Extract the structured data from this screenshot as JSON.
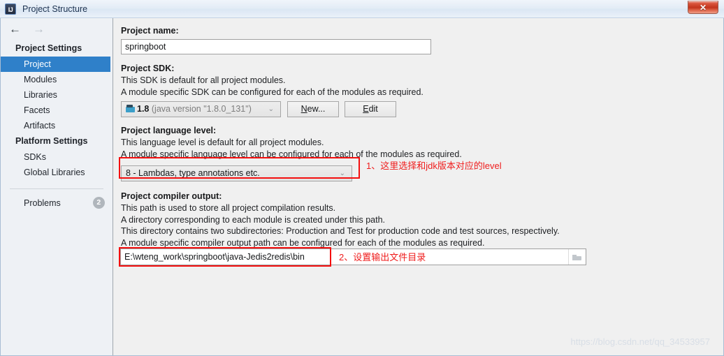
{
  "window": {
    "title": "Project Structure",
    "app_icon": "IJ",
    "close_label": "✕"
  },
  "nav": {
    "back_icon": "←",
    "forward_icon": "→"
  },
  "sidebar": {
    "groups": [
      {
        "header": "Project Settings",
        "items": [
          {
            "label": "Project",
            "selected": true
          },
          {
            "label": "Modules",
            "selected": false
          },
          {
            "label": "Libraries",
            "selected": false
          },
          {
            "label": "Facets",
            "selected": false
          },
          {
            "label": "Artifacts",
            "selected": false
          }
        ]
      },
      {
        "header": "Platform Settings",
        "items": [
          {
            "label": "SDKs",
            "selected": false
          },
          {
            "label": "Global Libraries",
            "selected": false
          }
        ]
      }
    ],
    "problems": {
      "label": "Problems",
      "badge": "2"
    }
  },
  "main": {
    "project_name": {
      "label": "Project name:",
      "value": "springboot"
    },
    "project_sdk": {
      "label": "Project SDK:",
      "desc_1": "This SDK is default for all project modules.",
      "desc_2": "A module specific SDK can be configured for each of the modules as required.",
      "combo_version": "1.8",
      "combo_detail": "(java version \"1.8.0_131\")",
      "combo_arrow": "⌄",
      "new_button": "New...",
      "new_button_mnemonic": "N",
      "edit_button": "Edit",
      "edit_button_mnemonic": "E"
    },
    "language_level": {
      "label": "Project language level:",
      "desc_1": "This language level is default for all project modules.",
      "desc_2": "A module specific language level can be configured for each of the modules as required.",
      "combo_value": "8 - Lambdas, type annotations etc.",
      "combo_arrow": "⌄"
    },
    "compiler_output": {
      "label": "Project compiler output:",
      "desc_1": "This path is used to store all project compilation results.",
      "desc_2": "A directory corresponding to each module is created under this path.",
      "desc_3": "This directory contains two subdirectories: Production and Test for production code and test sources, respectively.",
      "desc_4": "A module specific compiler output path can be configured for each of the modules as required.",
      "value": "E:\\wteng_work\\springboot\\java-Jedis2redis\\bin"
    }
  },
  "annotations": [
    {
      "text": "1、这里选择和jdk版本对应的level"
    },
    {
      "text": "2、设置输出文件目录"
    }
  ],
  "watermark": "https://blog.csdn.net/qq_34533957",
  "colors": {
    "selection_blue": "#2f80c9",
    "annotation_red": "#f40f0f",
    "close_red": "#c2341d",
    "watermark_gray": "#d8dee6"
  }
}
